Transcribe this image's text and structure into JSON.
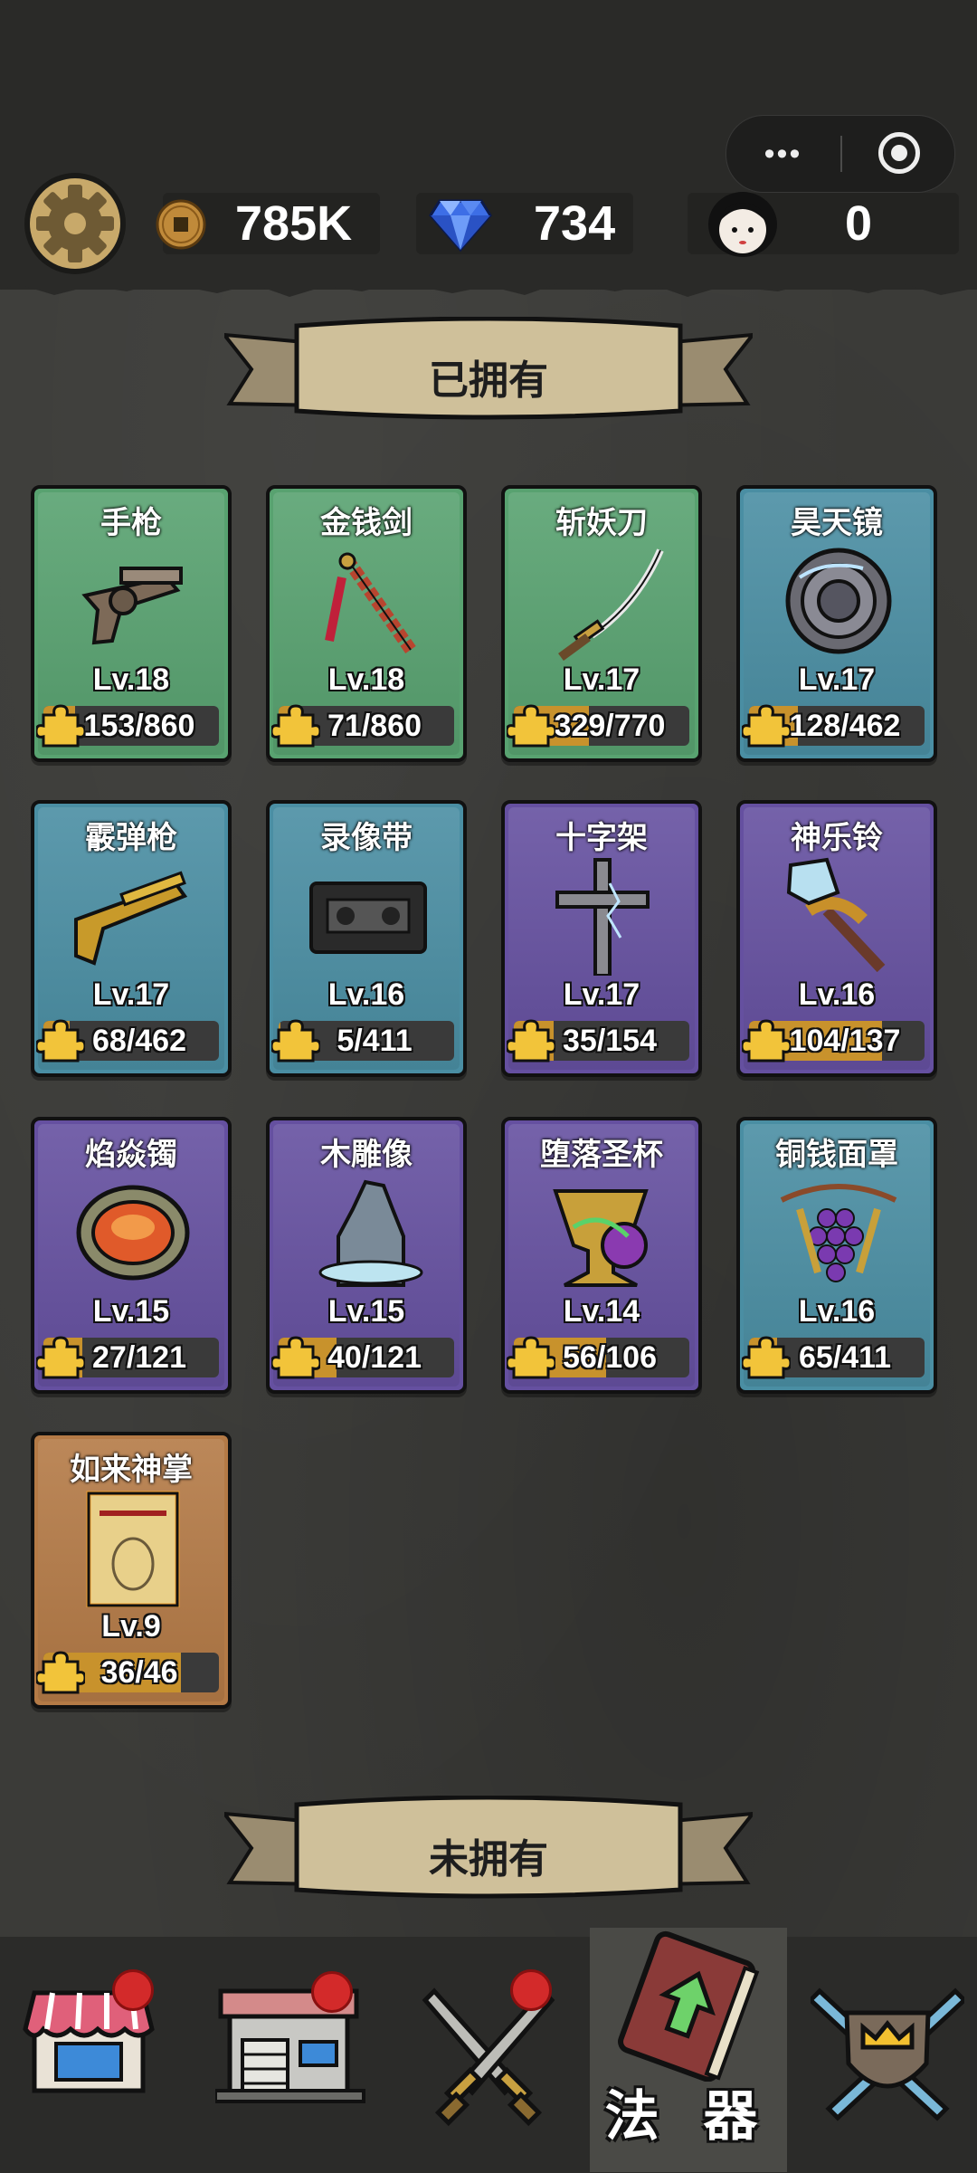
{
  "header": {
    "coins": "785K",
    "gems": "734",
    "tickets": "0"
  },
  "sections": {
    "owned_title": "已拥有",
    "unowned_title": "未拥有"
  },
  "items": [
    {
      "name": "手枪",
      "level": "Lv.18",
      "progress": "153/860",
      "rarity": "green",
      "icon": "revolver-icon"
    },
    {
      "name": "金钱剑",
      "level": "Lv.18",
      "progress": "71/860",
      "rarity": "green",
      "icon": "coin-sword-icon"
    },
    {
      "name": "斩妖刀",
      "level": "Lv.17",
      "progress": "329/770",
      "rarity": "green",
      "icon": "katana-icon"
    },
    {
      "name": "昊天镜",
      "level": "Lv.17",
      "progress": "128/462",
      "rarity": "blue",
      "icon": "mirror-shield-icon"
    },
    {
      "name": "霰弹枪",
      "level": "Lv.17",
      "progress": "68/462",
      "rarity": "blue",
      "icon": "shotgun-icon"
    },
    {
      "name": "录像带",
      "level": "Lv.16",
      "progress": "5/411",
      "rarity": "blue",
      "icon": "videotape-icon"
    },
    {
      "name": "十字架",
      "level": "Lv.17",
      "progress": "35/154",
      "rarity": "purple",
      "icon": "cross-icon"
    },
    {
      "name": "神乐铃",
      "level": "Lv.16",
      "progress": "104/137",
      "rarity": "purple",
      "icon": "bell-rattle-icon"
    },
    {
      "name": "焰焱镯",
      "level": "Lv.15",
      "progress": "27/121",
      "rarity": "purple",
      "icon": "flame-bracelet-icon"
    },
    {
      "name": "木雕像",
      "level": "Lv.15",
      "progress": "40/121",
      "rarity": "purple",
      "icon": "wood-statue-icon"
    },
    {
      "name": "堕落圣杯",
      "level": "Lv.14",
      "progress": "56/106",
      "rarity": "purple",
      "icon": "fallen-grail-icon"
    },
    {
      "name": "铜钱面罩",
      "level": "Lv.16",
      "progress": "65/411",
      "rarity": "blue",
      "icon": "coin-mask-icon"
    },
    {
      "name": "如来神掌",
      "level": "Lv.9",
      "progress": "36/46",
      "rarity": "gold",
      "icon": "palm-scroll-icon"
    }
  ],
  "nav": {
    "active_label": "法 器",
    "items": [
      "shop-icon",
      "building-icon",
      "crossed-swords-icon",
      "spellbook-icon",
      "crown-shield-icon"
    ]
  },
  "colors": {
    "green": "#58a270",
    "blue": "#4a8ea3",
    "purple": "#6550a0",
    "gold": "#b47a46",
    "progress": "#c8922c"
  }
}
